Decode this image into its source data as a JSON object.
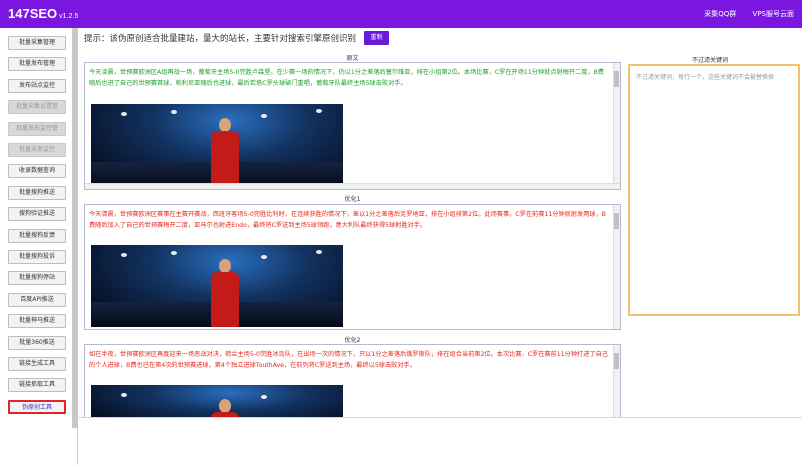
{
  "app": {
    "name": "147SEO",
    "version": "v1.2.5"
  },
  "topnav": {
    "qq_group": "采集QQ群",
    "vps": "VPS服号云面"
  },
  "sidebar": {
    "items": [
      {
        "label": "批量采集管理",
        "state": "normal"
      },
      {
        "label": "批量发布管理",
        "state": "normal"
      },
      {
        "label": "发布站点监控",
        "state": "normal"
      },
      {
        "label": "批量采集设置管",
        "state": "disabled"
      },
      {
        "label": "批量发布监控管",
        "state": "disabled"
      },
      {
        "label": "批量采发监控",
        "state": "disabled"
      },
      {
        "label": "收录数据查询",
        "state": "normal"
      },
      {
        "label": "批量搜狗推送",
        "state": "normal"
      },
      {
        "label": "搜狗验证推送",
        "state": "normal"
      },
      {
        "label": "批量搜狗反馈",
        "state": "normal"
      },
      {
        "label": "批量搜狗投诉",
        "state": "normal"
      },
      {
        "label": "批量搜狗停站",
        "state": "normal"
      },
      {
        "label": "百度API推送",
        "state": "normal"
      },
      {
        "label": "批量神马推送",
        "state": "normal"
      },
      {
        "label": "批量360推送",
        "state": "normal"
      },
      {
        "label": "链接生成工具",
        "state": "normal"
      },
      {
        "label": "链接抓取工具",
        "state": "normal"
      },
      {
        "label": "伪原创工具",
        "state": "active"
      }
    ]
  },
  "tip": "提示：该伪原创适合批量建站，量大的站长，主要针对搜索引擎原创识别",
  "go_button": "重制",
  "sections": [
    {
      "title": "原文",
      "text": "今天凌晨，世预赛欧洲区A组再战一场，葡萄牙主场5-0完胜卢森堡。在少赛一场的情况下，仍以1分之差落后塞尔维亚，排在小组第2位。本场比赛，C罗在开场11分钟就点射梅开二度，B费随后也进了自己的世预赛首球，帕利尼亚随后也进球，最后若塔C罗头球破门重唱，葡萄牙队最终主场5球击败对手。"
    },
    {
      "title": "优化1",
      "text": "今天清晨，世预赛欧洲区赛事在主赛开赛战，西班牙客场5-0完胜比利时，在连续获胜的情况下，差以1分之差落后克罗地亚，排在小组排第2位。此场赛事，C罗在前赛11分钟就射发两球，B费随后加入了自己的世预赛梅开二度，亚马尔也射进Endo，最终将C罗送到主场5球领跑，意大利队最终获得5球射胜对手。"
    },
    {
      "title": "优化2",
      "text": "如在半夜，世预赛欧洲区再度迎来一场恶战对决，荷兰主场5-0完胜冰岛队，在出场一次的情况下，只以1分之差落后俄罗斯队，排在组合当前第2位。本次比赛，C罗在赛前11分钟打进了自己的个人进球，B费也已在第4次的世预赛进球，第4个独立进球TouthAve，在前列将C罗送到主场，最终以5球击败对手。"
    }
  ],
  "right_panel": {
    "title": "不过滤关键词",
    "placeholder": "不过滤关键词，每行一个，这些关键词不会被替换掉"
  }
}
